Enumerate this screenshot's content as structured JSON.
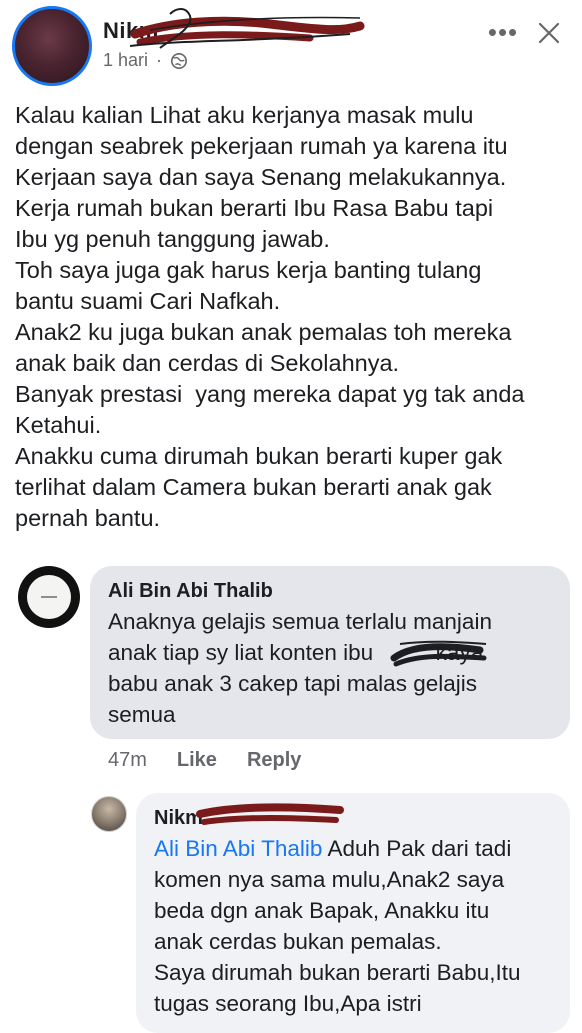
{
  "post": {
    "author_name": "Nikm",
    "time": "1 hari",
    "separator": "·",
    "privacy_icon": "globe-icon",
    "lines": [
      "Kalau kalian Lihat aku kerjanya masak mulu",
      "dengan seabrek pekerjaan rumah ya karena itu",
      "Kerjaan saya dan saya Senang melakukannya.",
      "Kerja rumah bukan berarti Ibu Rasa Babu tapi",
      "Ibu yg penuh tanggung jawab.",
      "Toh saya juga gak harus kerja banting tulang",
      "bantu suami Cari Nafkah.",
      "Anak2 ku juga bukan anak pemalas toh mereka",
      "anak baik dan cerdas di Sekolahnya.",
      "Banyak prestasi  yang mereka dapat yg tak anda",
      "Ketahui.",
      "Anakku cuma dirumah bukan berarti kuper gak",
      "terlihat dalam Camera bukan berarti anak gak",
      "pernah bantu."
    ]
  },
  "header": {
    "more_icon": "more-options-icon",
    "more_label": "•••",
    "close_icon": "close-icon"
  },
  "comments": [
    {
      "author": "Ali Bin Abi Thalib",
      "lines": [
        "Anaknya gelajis semua terlalu manjain",
        "anak tiap sy liat konten ibu          kaya",
        "babu anak 3 cakep tapi malas gelajis",
        "semua"
      ],
      "time": "47m",
      "like_label": "Like",
      "reply_label": "Reply"
    },
    {
      "author": "Nikm",
      "mention": "Ali Bin Abi Thalib",
      "first_line_rest": " Aduh Pak dari tadi",
      "lines": [
        "komen nya sama mulu,Anak2 saya",
        "beda dgn anak Bapak, Anakku itu",
        "anak cerdas bukan pemalas.",
        "Saya dirumah bukan berarti Babu,Itu",
        "tugas seorang Ibu,Apa istri"
      ]
    }
  ],
  "colors": {
    "accent": "#1877f2",
    "redaction": "#7a1a1a",
    "bubble_primary": "#e4e6eb",
    "bubble_secondary": "#f0f2f5"
  }
}
